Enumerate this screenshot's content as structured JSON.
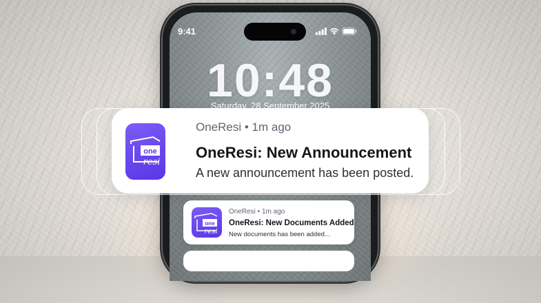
{
  "status_bar": {
    "time": "9:41",
    "icons": [
      "signal-icon",
      "wifi-icon",
      "battery-icon"
    ]
  },
  "lock_screen": {
    "clock": "10:48",
    "date": "Saturday, 28 September 2025"
  },
  "notifications": [
    {
      "app": "OneResi • 1m ago",
      "title": "OneResi: New Announcement",
      "body": "A new announcement has been posted."
    },
    {
      "app": "OneResi • 1m ago",
      "title": "OneResi: New Documents Added",
      "body": "New documents has been added..."
    }
  ],
  "colors": {
    "app_icon": "#6a46ee",
    "notification_bg": "#ffffff",
    "title_text": "#14161a"
  },
  "app_icon": {
    "wordmark_top": "one",
    "wordmark_bottom": "resi"
  }
}
